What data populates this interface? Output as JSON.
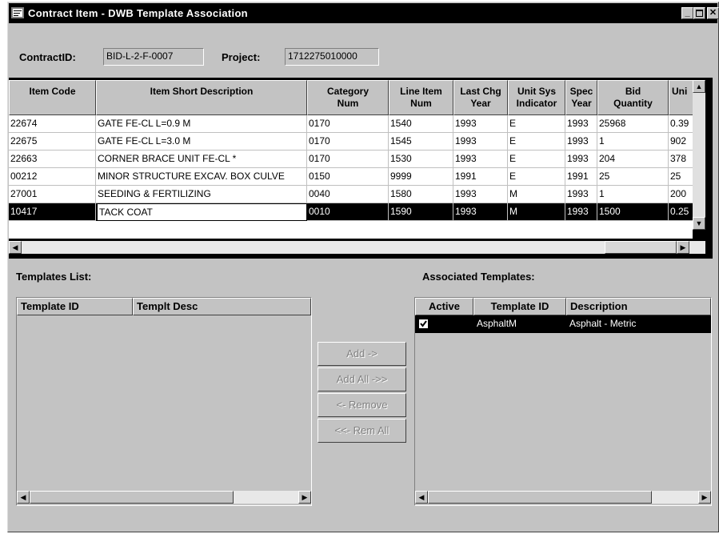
{
  "window": {
    "title": "Contract Item - DWB Template Association"
  },
  "header": {
    "contract_label": "ContractID:",
    "contract_value": "BID-L-2-F-0007",
    "project_label": "Project:",
    "project_value": "1712275010000"
  },
  "grid": {
    "columns": [
      "Item Code",
      "Item Short Description",
      "Category\nNum",
      "Line Item\nNum",
      "Last Chg\nYear",
      "Unit Sys\nIndicator",
      "Spec\nYear",
      "Bid\nQuantity",
      "Uni"
    ],
    "rows": [
      [
        "22674",
        "GATE FE-CL L=0.9 M",
        "0170",
        "1540",
        "1993",
        "E",
        "1993",
        "25968",
        "0.39"
      ],
      [
        "22675",
        "GATE FE-CL L=3.0 M",
        "0170",
        "1545",
        "1993",
        "E",
        "1993",
        "1",
        "902"
      ],
      [
        "22663",
        "CORNER BRACE UNIT FE-CL          *",
        "0170",
        "1530",
        "1993",
        "E",
        "1993",
        "204",
        "378"
      ],
      [
        "00212",
        "MINOR STRUCTURE EXCAV. BOX CULVE",
        "0150",
        "9999",
        "1991",
        "E",
        "1991",
        "25",
        "25"
      ],
      [
        "27001",
        "SEEDING & FERTILIZING",
        "0040",
        "1580",
        "1993",
        "M",
        "1993",
        "1",
        "200"
      ],
      [
        "10417",
        "TACK COAT",
        "0010",
        "1590",
        "1993",
        "M",
        "1993",
        "1500",
        "0.25"
      ]
    ],
    "selected_row": 5
  },
  "templates_list": {
    "label": "Templates List:",
    "columns": [
      "Template ID",
      "Templt Desc"
    ]
  },
  "associated": {
    "label": "Associated Templates:",
    "columns": [
      "Active",
      "Template ID",
      "Description"
    ],
    "rows": [
      {
        "active": true,
        "template_id": "AsphaltM",
        "description": "Asphalt - Metric"
      }
    ]
  },
  "buttons": {
    "add": "Add ->",
    "add_all": "Add All ->>",
    "remove": "<- Remove",
    "remove_all": "<<- Rem All"
  },
  "icons": [
    "app-icon",
    "minimize-icon",
    "maximize-icon",
    "close-icon",
    "scroll-up-icon",
    "scroll-down-icon",
    "scroll-left-icon",
    "scroll-right-icon",
    "check-icon"
  ],
  "colors": {
    "title_bar": "#000000",
    "window_face": "#c3c3c3",
    "selection": "#000000"
  }
}
